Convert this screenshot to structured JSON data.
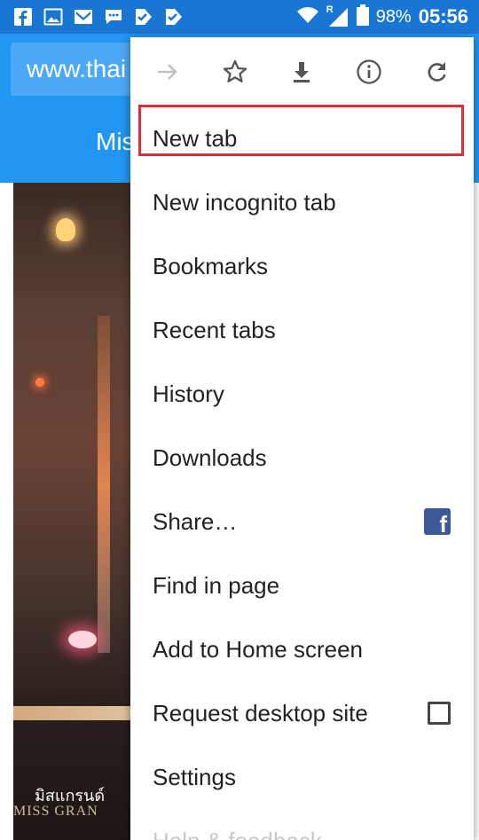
{
  "status_bar": {
    "battery_percent": "98%",
    "time": "05:56",
    "network_badge": "R",
    "left_icons": [
      "facebook-icon",
      "image-icon",
      "gmail-icon",
      "chat-icon",
      "check-badge-icon",
      "check-badge-icon"
    ],
    "right_icons": [
      "wifi-icon",
      "cell-signal-icon",
      "battery-icon"
    ]
  },
  "browser": {
    "url": "www.thai",
    "site_title": "Mis"
  },
  "page": {
    "photo_caption": "มิสแกรนด์",
    "photo_caption_2": "MISS GRAN"
  },
  "menu": {
    "top_icons": [
      {
        "name": "forward-arrow-icon",
        "disabled": true
      },
      {
        "name": "star-icon",
        "disabled": false
      },
      {
        "name": "download-icon",
        "disabled": false
      },
      {
        "name": "info-icon",
        "disabled": false
      },
      {
        "name": "refresh-icon",
        "disabled": false
      }
    ],
    "items": [
      {
        "id": "new-tab",
        "label": "New tab"
      },
      {
        "id": "new-incognito-tab",
        "label": "New incognito tab",
        "highlighted": true
      },
      {
        "id": "bookmarks",
        "label": "Bookmarks"
      },
      {
        "id": "recent-tabs",
        "label": "Recent tabs"
      },
      {
        "id": "history",
        "label": "History"
      },
      {
        "id": "downloads",
        "label": "Downloads"
      },
      {
        "id": "share",
        "label": "Share…",
        "trailing_icon": "facebook-icon"
      },
      {
        "id": "find-in-page",
        "label": "Find in page"
      },
      {
        "id": "add-to-home-screen",
        "label": "Add to Home screen"
      },
      {
        "id": "request-desktop-site",
        "label": "Request desktop site",
        "checkbox_checked": false
      },
      {
        "id": "settings",
        "label": "Settings"
      },
      {
        "id": "help-feedback",
        "label": "Help & feedback"
      }
    ]
  },
  "colors": {
    "status_bar": "#1976d2",
    "toolbar": "#2196f3",
    "highlight_border": "#e02d3a",
    "facebook": "#3b5998"
  }
}
